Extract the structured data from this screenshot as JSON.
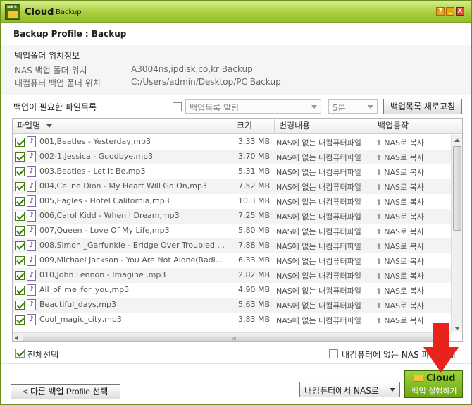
{
  "window": {
    "logo_text": "NAS",
    "title": "Cloud",
    "title_suffix": "Backup",
    "help_label": "?",
    "minimize_label": "_",
    "close_label": "X"
  },
  "profile": {
    "title": "Backup Profile : Backup"
  },
  "folder_info": {
    "heading": "백업폴더 위치정보",
    "nas_label": "NAS 백업 폴더 위치",
    "nas_value": "A3004ns,ipdisk,co,kr  Backup",
    "pc_label": "내컴퓨터 백업 폴더 위치",
    "pc_value": "C:/Users/admin/Desktop/PC Backup"
  },
  "file_list": {
    "heading": "백업이 필요한 파일목록",
    "alert_select_value": "백업목록 알림",
    "interval_select_value": "5분",
    "refresh_button": "백업목록 새로고침",
    "columns": {
      "name": "파일명",
      "size": "크기",
      "change": "변경내용",
      "action": "백업동작"
    },
    "rows": [
      {
        "name": "001,Beatles - Yesterday,mp3",
        "size": "3,33 MB",
        "change": "NAS에 없는 내컴퓨터파일",
        "action": "NAS로 복사"
      },
      {
        "name": "002-1,Jessica - Goodbye,mp3",
        "size": "3,70 MB",
        "change": "NAS에 없는 내컴퓨터파일",
        "action": "NAS로 복사"
      },
      {
        "name": "003,Beatles - Let It Be,mp3",
        "size": "5,31 MB",
        "change": "NAS에 없는 내컴퓨터파일",
        "action": "NAS로 복사"
      },
      {
        "name": "004,Celine Dion - My Heart Will Go On,mp3",
        "size": "7,52 MB",
        "change": "NAS에 없는 내컴퓨터파일",
        "action": "NAS로 복사"
      },
      {
        "name": "005,Eagles - Hotel California,mp3",
        "size": "10,3 MB",
        "change": "NAS에 없는 내컴퓨터파일",
        "action": "NAS로 복사"
      },
      {
        "name": "006,Carol Kidd - When I Dream,mp3",
        "size": "7,25 MB",
        "change": "NAS에 없는 내컴퓨터파일",
        "action": "NAS로 복사"
      },
      {
        "name": "007,Queen - Love Of My Life,mp3",
        "size": "5,80 MB",
        "change": "NAS에 없는 내컴퓨터파일",
        "action": "NAS로 복사"
      },
      {
        "name": "008,Simon _Garfunkle - Bridge Over Troubled ...",
        "size": "7,88 MB",
        "change": "NAS에 없는 내컴퓨터파일",
        "action": "NAS로 복사"
      },
      {
        "name": "009,Michael Jackson - You Are Not Alone(Radi...",
        "size": "6,33 MB",
        "change": "NAS에 없는 내컴퓨터파일",
        "action": "NAS로 복사"
      },
      {
        "name": "010,John Lennon - Imagine ,mp3",
        "size": "2,82 MB",
        "change": "NAS에 없는 내컴퓨터파일",
        "action": "NAS로 복사"
      },
      {
        "name": "All_of_me_for_you,mp3",
        "size": "4,90 MB",
        "change": "NAS에 없는 내컴퓨터파일",
        "action": "NAS로 복사"
      },
      {
        "name": "Beautiful_days,mp3",
        "size": "5,63 MB",
        "change": "NAS에 없는 내컴퓨터파일",
        "action": "NAS로 복사"
      },
      {
        "name": "Cool_magic_city,mp3",
        "size": "3,83 MB",
        "change": "NAS에 없는 내컴퓨터파일",
        "action": "NAS로 복사"
      }
    ],
    "file_icon_glyph": "♪",
    "action_arrow_glyph": "⬆",
    "hscroll_grip": "III"
  },
  "footer": {
    "select_all_label": "전체선택",
    "delete_label": "내컴퓨터에 없는 NAS 파일 삭제",
    "back_button": "< 다른 백업 Profile 선택",
    "direction_value": "내컴퓨터에서 NAS로",
    "run_button_title": "Cloud",
    "run_button_sub": "백업 실행하기"
  },
  "colors": {
    "titlebar": "#a9cf3f",
    "accent_green": "#6ea812",
    "arrow_red": "#e8231b"
  }
}
